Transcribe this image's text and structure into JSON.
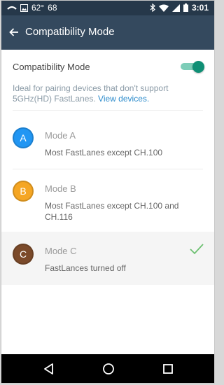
{
  "status_bar": {
    "temperature": "62°",
    "extra": "68",
    "time": "3:01",
    "left_icons": [
      "voicemail-icon",
      "image-icon"
    ],
    "right_icons": [
      "bluetooth-icon",
      "wifi-icon",
      "signal-icon",
      "battery-icon"
    ]
  },
  "app_bar": {
    "title": "Compatibility Mode",
    "back_icon": "arrow-left-icon"
  },
  "compat_setting": {
    "label": "Compatibility Mode",
    "enabled": true
  },
  "description": {
    "text": "Ideal for pairing devices that don't support 5GHz(HD) FastLanes.",
    "link": "View devices."
  },
  "modes": [
    {
      "letter": "A",
      "title": "Mode A",
      "description": "Most FastLanes except CH.100",
      "color": "#2196f3",
      "selected": false
    },
    {
      "letter": "B",
      "title": "Mode B",
      "description": "Most FastLanes except CH.100 and CH.116",
      "color": "#f5a623",
      "selected": false
    },
    {
      "letter": "C",
      "title": "Mode C",
      "description": "FastLances turned off",
      "color": "#7b4a2a",
      "selected": true
    }
  ],
  "colors": {
    "status_bar": "#26384a",
    "app_bar": "#34495e",
    "accent": "#0f8f75",
    "link": "#2a8acb",
    "check": "#6cc070"
  },
  "nav_bar": {
    "buttons": [
      "back-triangle-icon",
      "home-circle-icon",
      "recents-square-icon"
    ]
  }
}
